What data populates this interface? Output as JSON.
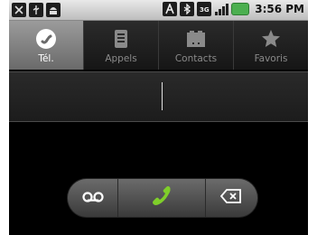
{
  "status_bar": {
    "time": "3:56 PM",
    "left_icons": [
      "usb-debug-icon",
      "usb-icon",
      "android-icon"
    ],
    "right_icons": [
      "a-notification-icon",
      "bluetooth-icon",
      "3g-icon",
      "signal-icon",
      "battery-icon"
    ],
    "battery_color": "#4caf50"
  },
  "tabs": [
    {
      "label": "Tél.",
      "icon": "phone-icon",
      "active": true
    },
    {
      "label": "Appels",
      "icon": "call-log-icon",
      "active": false
    },
    {
      "label": "Contacts",
      "icon": "contacts-icon",
      "active": false
    },
    {
      "label": "Favoris",
      "icon": "star-icon",
      "active": false
    }
  ],
  "dialer": {
    "digits_value": ""
  },
  "actions": {
    "voicemail_icon": "voicemail-icon",
    "call_icon": "call-icon",
    "delete_icon": "backspace-icon",
    "call_color": "#7fcf2a"
  }
}
